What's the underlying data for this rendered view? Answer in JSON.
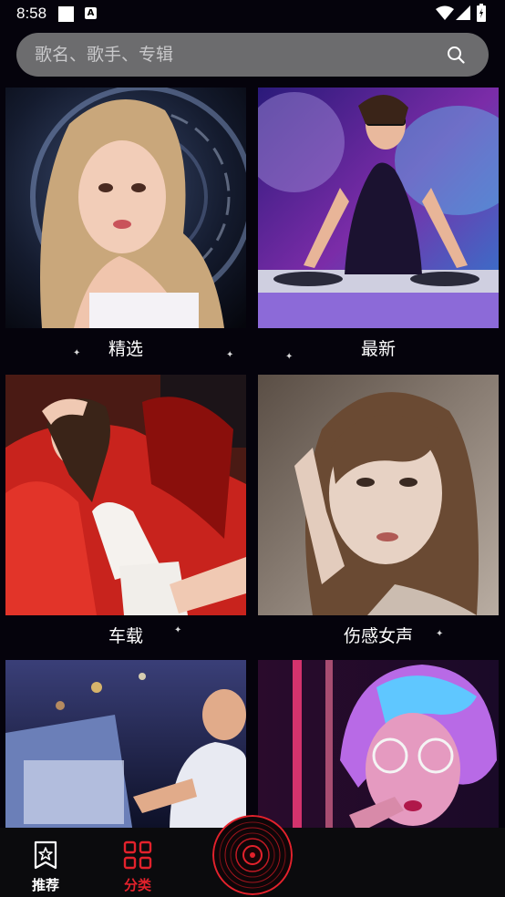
{
  "status_bar": {
    "time": "8:58",
    "icons": [
      "notification-square-icon",
      "a-notification-icon",
      "wifi-icon",
      "cell-signal-icon",
      "battery-icon"
    ]
  },
  "search": {
    "placeholder": "歌名、歌手、专辑",
    "icon": "search-icon"
  },
  "categories": [
    {
      "label": "精选"
    },
    {
      "label": "最新"
    },
    {
      "label": "车载"
    },
    {
      "label": "伤感女声"
    },
    {
      "label": ""
    },
    {
      "label": ""
    }
  ],
  "bottom_nav": {
    "items": [
      {
        "label": "推荐",
        "icon": "star-bookmark-icon",
        "active": false
      },
      {
        "label": "分类",
        "icon": "grid-icon",
        "active": true
      }
    ],
    "center": {
      "icon": "vinyl-disc-icon"
    }
  },
  "colors": {
    "active": "#e3222c",
    "inactive": "#ffffff",
    "search_bg": "#6c6c6e",
    "background": "#05030c"
  }
}
